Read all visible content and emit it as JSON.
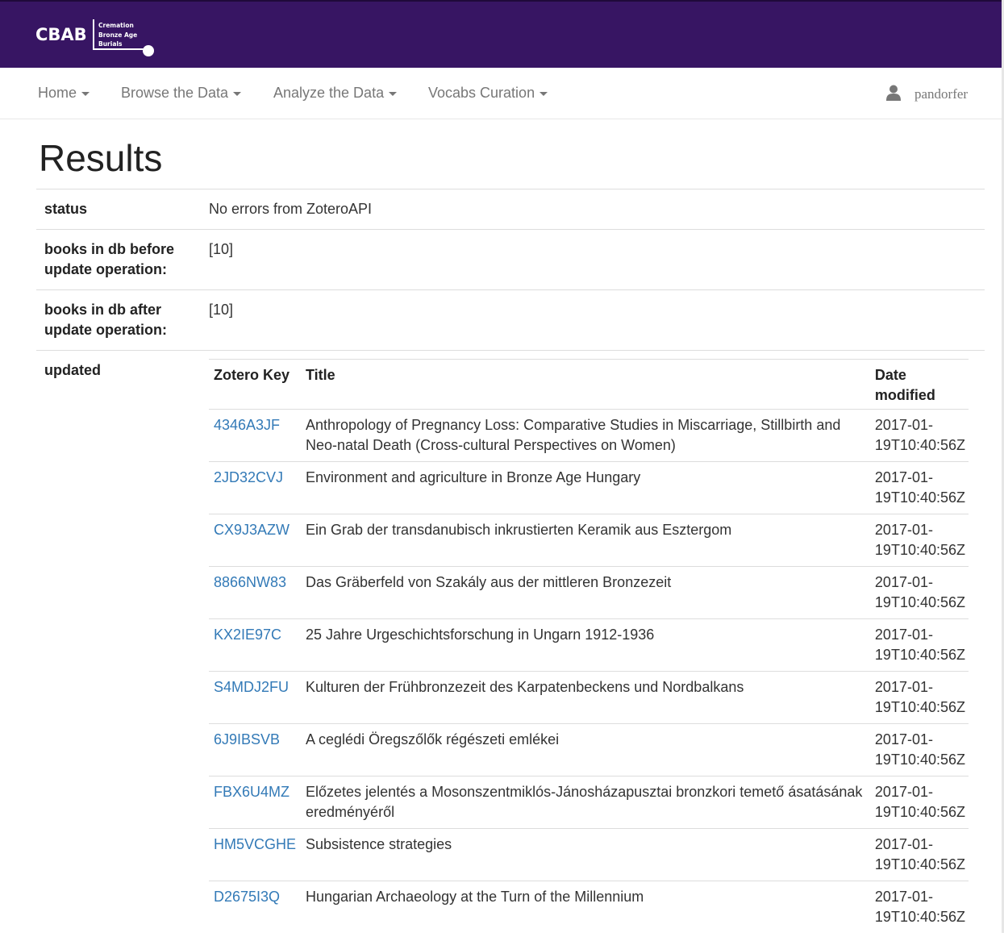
{
  "brand": {
    "abbr": "CBAB",
    "line1": "Cremation",
    "line2": "Bronze Age",
    "line3": "Burials",
    "color": "#371563"
  },
  "nav": {
    "items": [
      {
        "label": "Home"
      },
      {
        "label": "Browse the Data"
      },
      {
        "label": "Analyze the Data"
      },
      {
        "label": "Vocabs Curation"
      }
    ],
    "user": {
      "name": "pandorfer",
      "icon": "user-icon"
    }
  },
  "page": {
    "title": "Results"
  },
  "results": {
    "status_label": "status",
    "status_value": "No errors from ZoteroAPI",
    "before_label": "books in db before update operation:",
    "before_value": "[10]",
    "after_label": "books in db after update operation:",
    "after_value": "[10]",
    "updated_label": "updated",
    "table": {
      "headers": {
        "key": "Zotero Key",
        "title": "Title",
        "date": "Date modified"
      },
      "rows": [
        {
          "key": "4346A3JF",
          "title": "Anthropology of Pregnancy Loss: Comparative Studies in Miscarriage, Stillbirth and Neo-natal Death (Cross-cultural Perspectives on Women)",
          "date": "2017-01-19T10:40:56Z"
        },
        {
          "key": "2JD32CVJ",
          "title": "Environment and agriculture in Bronze Age Hungary",
          "date": "2017-01-19T10:40:56Z"
        },
        {
          "key": "CX9J3AZW",
          "title": "Ein Grab der transdanubisch inkrustierten Keramik aus Esztergom",
          "date": "2017-01-19T10:40:56Z"
        },
        {
          "key": "8866NW83",
          "title": "Das Gräberfeld von Szakály aus der mittleren Bronzezeit",
          "date": "2017-01-19T10:40:56Z"
        },
        {
          "key": "KX2IE97C",
          "title": "25 Jahre Urgeschichtsforschung in Ungarn 1912-1936",
          "date": "2017-01-19T10:40:56Z"
        },
        {
          "key": "S4MDJ2FU",
          "title": "Kulturen der Frühbronzezeit des Karpatenbeckens und Nordbalkans",
          "date": "2017-01-19T10:40:56Z"
        },
        {
          "key": "6J9IBSVB",
          "title": "A ceglédi Öregszőlők régészeti emlékei",
          "date": "2017-01-19T10:40:56Z"
        },
        {
          "key": "FBX6U4MZ",
          "title": "Előzetes jelentés a Mosonszentmiklós-Jánosházapusztai bronzkori temető ásatásának eredményéről",
          "date": "2017-01-19T10:40:56Z"
        },
        {
          "key": "HM5VCGHE",
          "title": "Subsistence strategies",
          "date": "2017-01-19T10:40:56Z"
        },
        {
          "key": "D2675I3Q",
          "title": "Hungarian Archaeology at the Turn of the Millennium",
          "date": "2017-01-19T10:40:56Z"
        }
      ]
    }
  },
  "colors": {
    "link": "#337ab7",
    "nav_text": "#777777",
    "border": "#dddddd"
  }
}
